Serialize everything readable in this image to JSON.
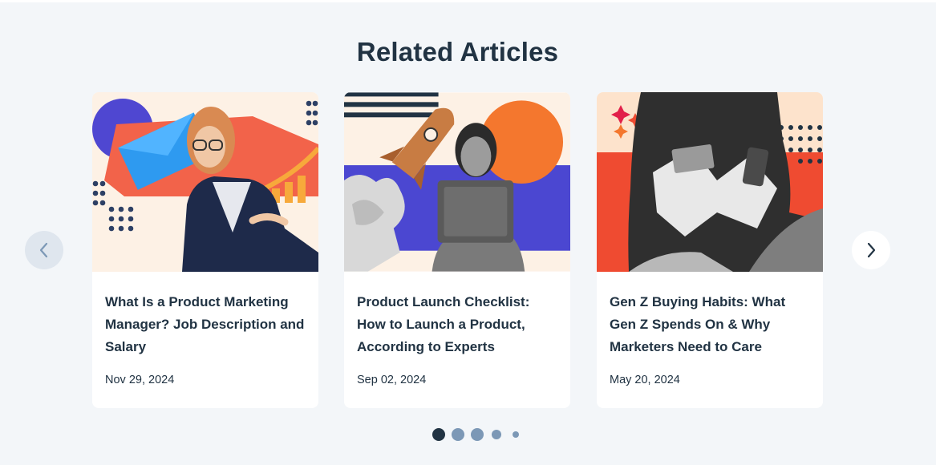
{
  "section": {
    "heading": "Related Articles"
  },
  "articles": [
    {
      "title": "What Is a Product Marketing Manager? Job Description and Salary",
      "date": "Nov 29, 2024",
      "image": "product-marketing-manager-illustration"
    },
    {
      "title": "Product Launch Checklist: How to Launch a Product, According to Experts",
      "date": "Sep 02, 2024",
      "image": "product-launch-illustration"
    },
    {
      "title": "Gen Z Buying Habits: What Gen Z Spends On & Why Marketers Need to Care",
      "date": "May 20, 2024",
      "image": "gen-z-buying-illustration"
    }
  ],
  "carousel": {
    "prev_icon": "chevron-left-icon",
    "next_icon": "chevron-right-icon",
    "page_count": 5,
    "active_page": 1
  },
  "colors": {
    "background": "#f3f6f9",
    "text": "#213343",
    "accent_orange": "#f4772e",
    "accent_blue": "#4f47d1",
    "accent_red": "#ef4b31"
  }
}
